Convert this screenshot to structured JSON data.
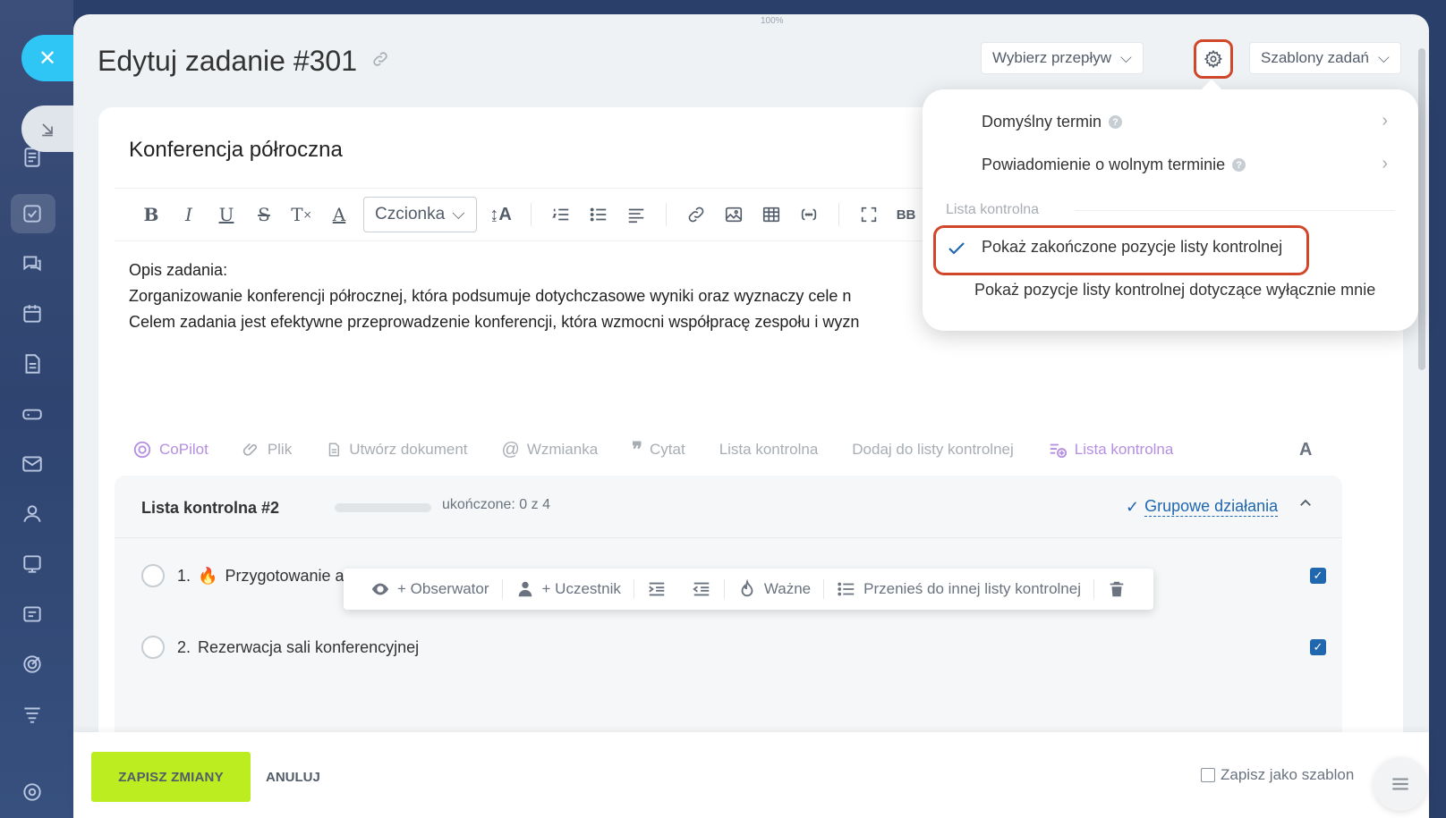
{
  "window": {
    "zoom": "100%"
  },
  "header": {
    "title": "Edytuj zadanie #301",
    "flow_button": "Wybierz przepływ",
    "templates_button": "Szablony zadań"
  },
  "task": {
    "title": "Konferencja półroczna",
    "description": [
      "Opis zadania:",
      "Zorganizowanie konferencji półrocznej, która podsumuje dotychczasowe wyniki oraz wyznaczy cele n",
      "Celem zadania jest efektywne przeprowadzenie konferencji, która wzmocni współpracę zespołu i wyzn"
    ]
  },
  "editor_toolbar": {
    "font_select": "Czcionka"
  },
  "actions": {
    "copilot": "CoPilot",
    "file": "Plik",
    "create_document": "Utwórz dokument",
    "mention": "Wzmianka",
    "quote": "Cytat",
    "checklist": "Lista kontrolna",
    "add_to_checklist": "Dodaj do listy kontrolnej",
    "checklist_new": "Lista kontrolna"
  },
  "checklist": {
    "title": "Lista kontrolna #2",
    "progress": 0,
    "count": "ukończone: 0 z 4",
    "group_actions": "Grupowe działania",
    "items": [
      {
        "number": "1.",
        "text": "Przygotowanie ag",
        "important": true
      },
      {
        "number": "2.",
        "text": "Rezerwacja sali konferencyjnej",
        "important": false
      }
    ]
  },
  "item_toolbar": {
    "observer": "+ Obserwator",
    "participant": "+ Uczestnik",
    "important": "Ważne",
    "move": "Przenieś do innej listy kontrolnej"
  },
  "bottom": {
    "save": "ZAPISZ ZMIANY",
    "cancel": "ANULUJ",
    "save_template": "Zapisz jako szablon"
  },
  "popup": {
    "default_deadline": "Domyślny termin",
    "free_deadline_notification": "Powiadomienie o wolnym terminie",
    "section_label": "Lista kontrolna",
    "show_completed": "Pokaż zakończone pozycje listy kontrolnej",
    "show_only_mine": "Pokaż pozycje listy kontrolnej dotyczące wyłącznie mnie"
  },
  "colors": {
    "accent_blue": "#2067b0",
    "highlight_red": "#d0472a",
    "save_green": "#bbed21",
    "close_blue": "#2fc6f6"
  }
}
